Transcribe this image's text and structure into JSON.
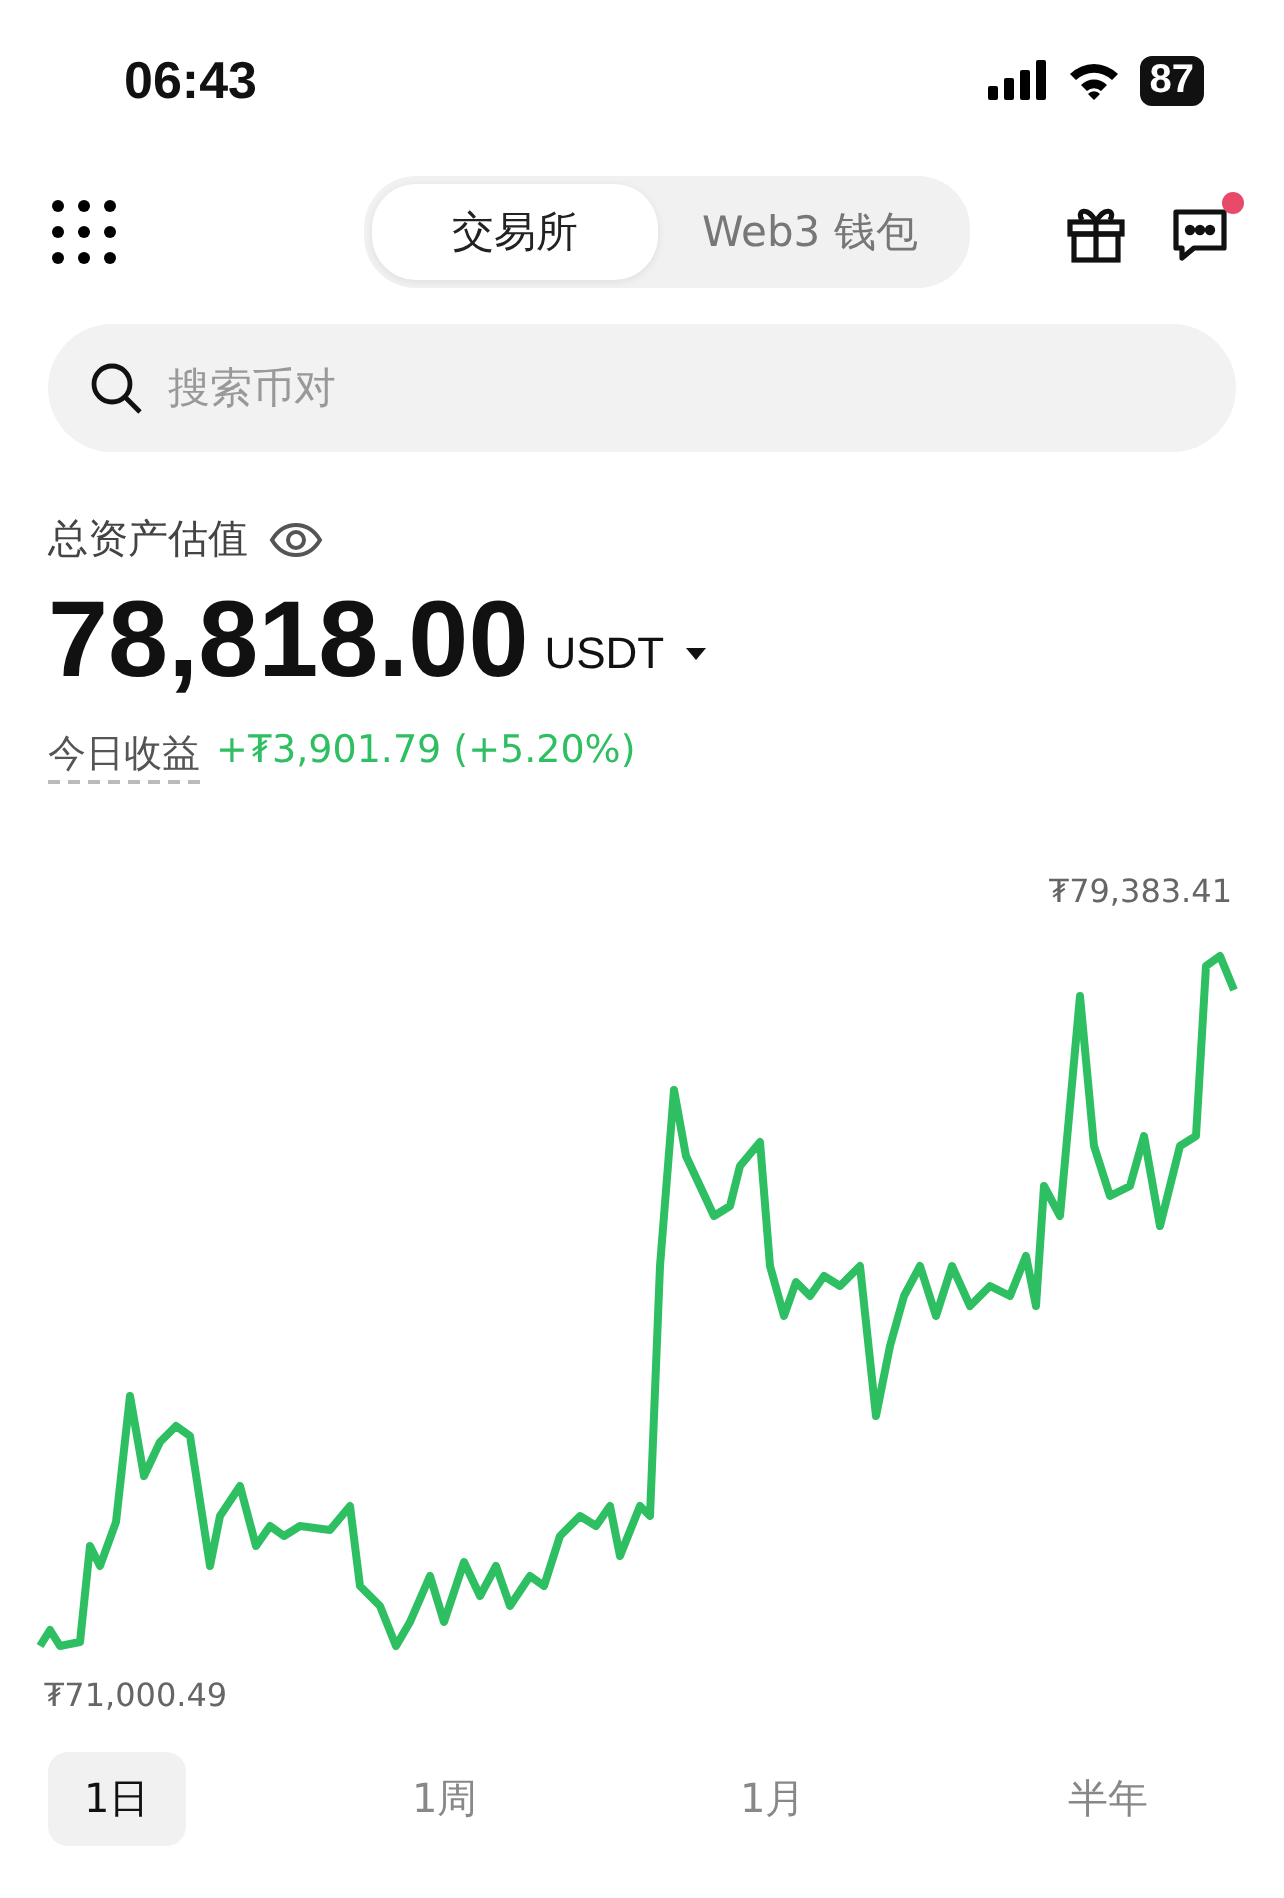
{
  "status_bar": {
    "time": "06:43",
    "battery": "87"
  },
  "header": {
    "tabs": [
      {
        "label": "交易所",
        "selected": true
      },
      {
        "label": "Web3 钱包",
        "selected": false
      }
    ],
    "notification_dot": true
  },
  "search": {
    "placeholder": "搜索币对"
  },
  "balance": {
    "label": "总资产估值",
    "amount": "78,818.00",
    "unit": "USDT",
    "today_label": "今日收益",
    "today_change": "+₮3,901.79 (+5.20%)"
  },
  "chart": {
    "max_label": "₮79,383.41",
    "min_label": "₮71,000.49"
  },
  "ranges": [
    {
      "label": "1日",
      "selected": true
    },
    {
      "label": "1周",
      "selected": false
    },
    {
      "label": "1月",
      "selected": false
    },
    {
      "label": "半年",
      "selected": false
    }
  ]
}
